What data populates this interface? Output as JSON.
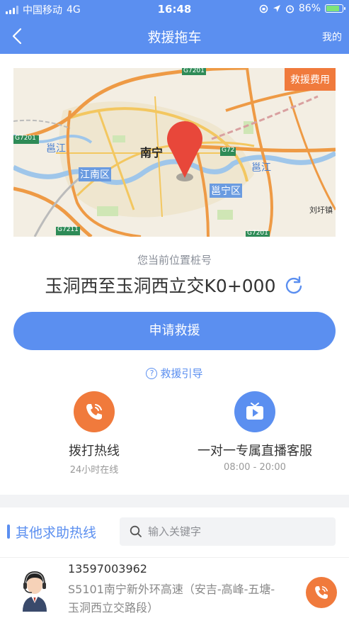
{
  "status": {
    "carrier": "中国移动",
    "network": "4G",
    "time": "16:48",
    "battery": "86%",
    "battery_level": 0.86
  },
  "nav": {
    "title": "救援拖车",
    "right_label": "我的"
  },
  "map": {
    "fee_label": "救援费用",
    "labels": {
      "city": "南宁",
      "district1": "江南区",
      "district2": "邕宁区",
      "river1": "邕江",
      "river2": "邕江",
      "highway1": "G7201",
      "highway2": "G7201",
      "highway3": "G72",
      "highway4": "G7211",
      "highway5": "G7201",
      "town": "刘圩镇"
    }
  },
  "location": {
    "label": "您当前位置桩号",
    "value": "玉洞西至玉洞西立交K0+000"
  },
  "apply_button": "申请救援",
  "guide_label": "救援引导",
  "actions": [
    {
      "title": "拨打热线",
      "sub": "24小时在线",
      "color": "#f07a3c"
    },
    {
      "title": "一对一专属直播客服",
      "sub": "08:00 - 20:00",
      "color": "#5b8ff0"
    }
  ],
  "hotlines": {
    "title": "其他求助热线",
    "search_placeholder": "输入关键字",
    "items": [
      {
        "phone": "13597003962",
        "desc": "S5101南宁新外环高速（安吉-高峰-五塘-玉洞西立交路段）"
      }
    ]
  },
  "colors": {
    "primary": "#5b8ff0",
    "accent": "#f07a3c"
  }
}
